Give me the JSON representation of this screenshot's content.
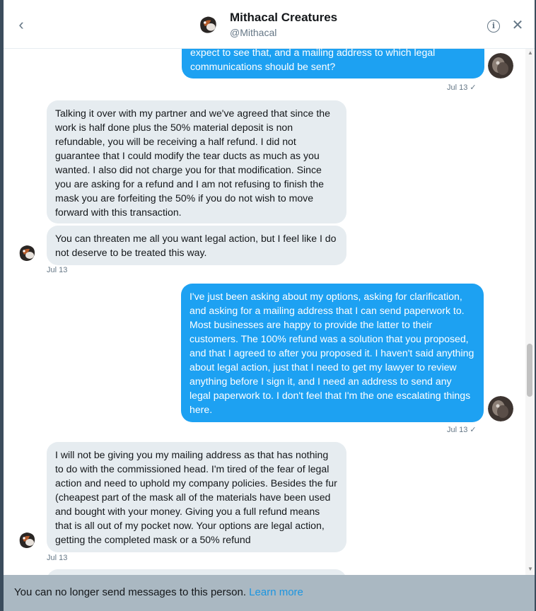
{
  "header": {
    "name": "Mithacal Creatures",
    "handle": "@Mithacal",
    "back_icon": "chevron-left-icon",
    "info_icon": "info-icon",
    "close_icon": "close-icon"
  },
  "messages": [
    {
      "direction": "out",
      "text": "expect to see that, and a mailing address to which legal communications should be sent?"
    },
    {
      "stamp": "Jul 13 ✓"
    },
    {
      "direction": "in",
      "text": "Talking it over with my partner and we've agreed that since the work is half done plus the 50% material deposit is non refundable, you will be receiving a half refund. I did not guarantee that I could modify the tear ducts as much as you wanted. I also did not charge you for that modification. Since you are asking for a refund and I am not refusing to finish the mask you are forfeiting the 50% if you do not wish to move forward with this transaction."
    },
    {
      "direction": "in",
      "text": "You can threaten me all you want  legal action, but I feel like I do not deserve to be treated this way."
    },
    {
      "stamp": "Jul 13"
    },
    {
      "direction": "out",
      "text": "I've just been asking about my options, asking for clarification, and asking for a mailing address that I can send paperwork to. Most businesses are happy to provide the latter to their customers. The 100% refund was a solution that you proposed, and that I agreed to after you proposed it. I haven't said anything about legal action, just that I need to get my lawyer to review anything before I sign it, and I need an address to send any legal paperwork to. I don't feel that I'm the one escalating things here."
    },
    {
      "stamp": "Jul 13 ✓"
    },
    {
      "direction": "in",
      "text": "I will not be giving you my mailing address as that has nothing to do with the commissioned head. I'm tired of the fear of legal action and need to uphold my company policies. Besides the fur (cheapest part of the mask all of the materials have been used and bought with your money. Giving you a full refund means that is all out of my pocket now. Your options are legal action, getting the completed mask or a 50% refund"
    },
    {
      "stamp": "Jul 13"
    }
  ],
  "footer": {
    "notice": "You can no longer send messages to this person.",
    "link": "Learn more"
  },
  "colors": {
    "outgoing_bubble": "#1da1f2",
    "incoming_bubble": "#e6ecf0",
    "footer_bg": "#aab8c2",
    "link": "#1b95e0"
  }
}
